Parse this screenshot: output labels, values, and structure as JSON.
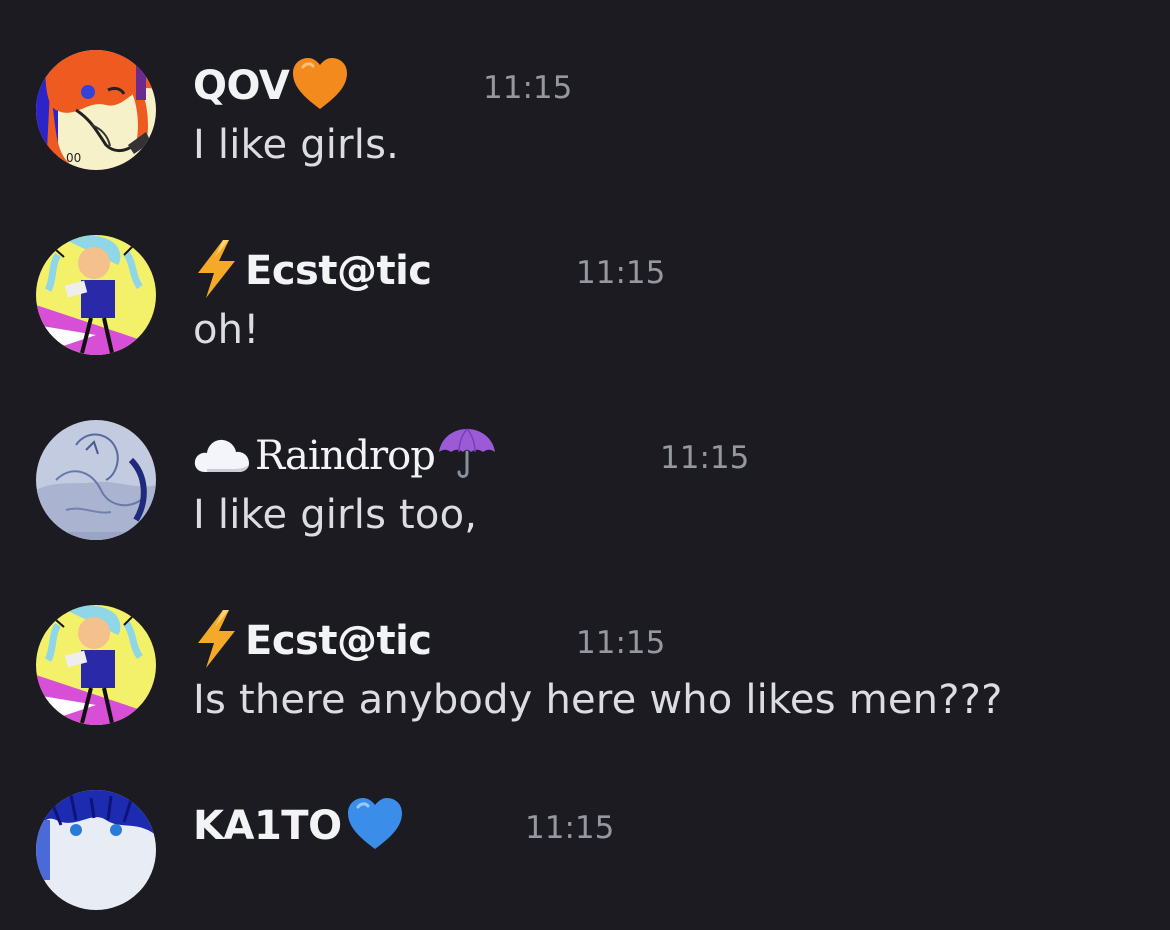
{
  "messages": [
    {
      "avatar": "orange-haired-anime-avatar",
      "username": "QOV",
      "name_suffix_icon": "orange-heart-icon",
      "timestamp": "11:15",
      "text": "I like girls."
    },
    {
      "avatar": "yellow-cartoon-avatar",
      "name_prefix_icon": "lightning-icon",
      "username": "Ecst@tic",
      "timestamp": "11:15",
      "text": "oh!"
    },
    {
      "avatar": "pale-blue-sketch-avatar",
      "name_prefix_icon": "cloud-icon",
      "username": "Raindrop",
      "name_suffix_icon": "umbrella-icon",
      "timestamp": "11:15",
      "text": "I like girls too,"
    },
    {
      "avatar": "yellow-cartoon-avatar",
      "name_prefix_icon": "lightning-icon",
      "username": "Ecst@tic",
      "timestamp": "11:15",
      "text": "Is there anybody here who likes men???"
    },
    {
      "avatar": "blue-haired-anime-avatar",
      "username": "KA1TO",
      "name_suffix_icon": "blue-heart-icon",
      "timestamp": "11:15",
      "text": ""
    }
  ],
  "colors": {
    "background": "#1b1b21",
    "username": "#f2f3f5",
    "timestamp": "#9598a0",
    "message_text": "#dcdde1",
    "orange_heart": "#f28a1e",
    "blue_heart": "#3a8eea",
    "lightning": "#f4a928",
    "umbrella": "#9b5bd6"
  }
}
